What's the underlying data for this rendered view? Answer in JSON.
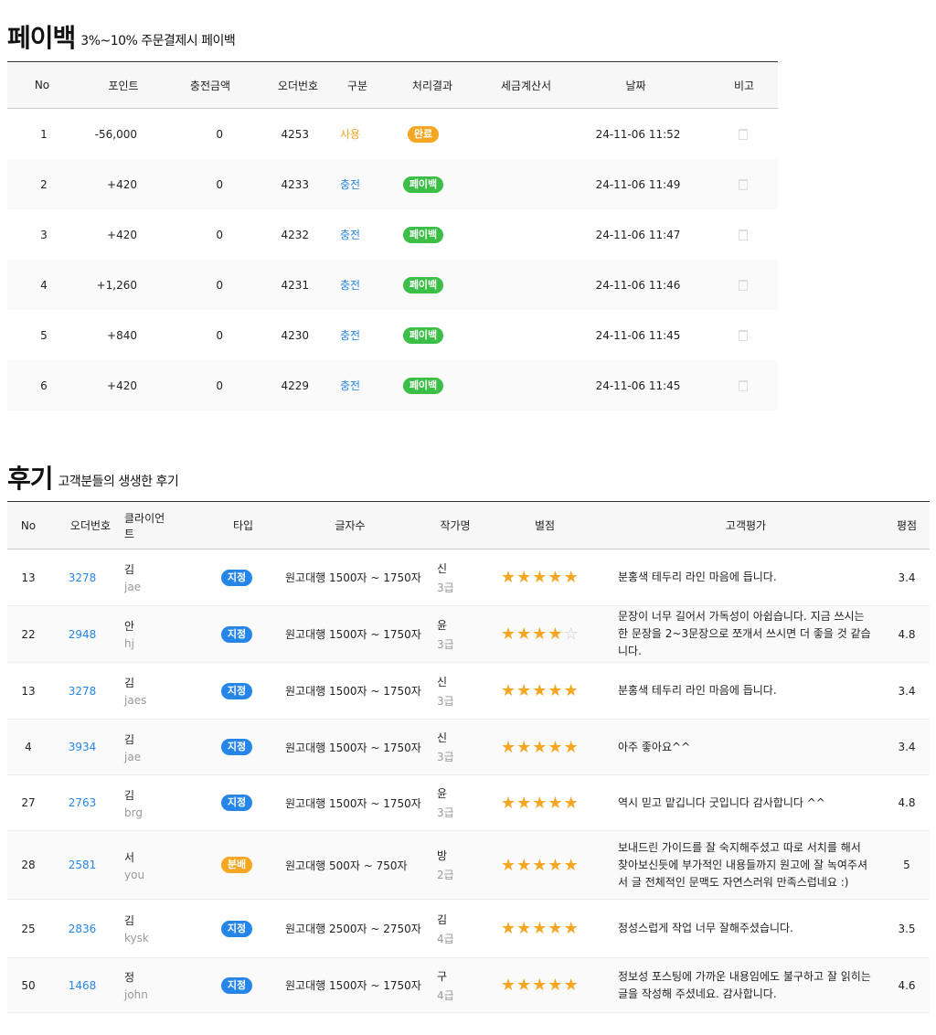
{
  "payback": {
    "title": "페이백",
    "subtitle": "3%~10% 주문결제시 페이백",
    "headers": [
      "No",
      "포인트",
      "충전금액",
      "오더번호",
      "구분",
      "처리결과",
      "세금계산서",
      "날짜",
      "비고"
    ],
    "rows": [
      {
        "no": "1",
        "point": "-56,000",
        "charge": "0",
        "order": "4253",
        "type": "사용",
        "type_kind": "use",
        "result": "완료",
        "result_kind": "orange",
        "tax": "",
        "date": "24-11-06 11:52"
      },
      {
        "no": "2",
        "point": "+420",
        "charge": "0",
        "order": "4233",
        "type": "충전",
        "type_kind": "charge",
        "result": "페이백",
        "result_kind": "green",
        "tax": "",
        "date": "24-11-06 11:49"
      },
      {
        "no": "3",
        "point": "+420",
        "charge": "0",
        "order": "4232",
        "type": "충전",
        "type_kind": "charge",
        "result": "페이백",
        "result_kind": "green",
        "tax": "",
        "date": "24-11-06 11:47"
      },
      {
        "no": "4",
        "point": "+1,260",
        "charge": "0",
        "order": "4231",
        "type": "충전",
        "type_kind": "charge",
        "result": "페이백",
        "result_kind": "green",
        "tax": "",
        "date": "24-11-06 11:46"
      },
      {
        "no": "5",
        "point": "+840",
        "charge": "0",
        "order": "4230",
        "type": "충전",
        "type_kind": "charge",
        "result": "페이백",
        "result_kind": "green",
        "tax": "",
        "date": "24-11-06 11:45"
      },
      {
        "no": "6",
        "point": "+420",
        "charge": "0",
        "order": "4229",
        "type": "충전",
        "type_kind": "charge",
        "result": "페이백",
        "result_kind": "green",
        "tax": "",
        "date": "24-11-06 11:45"
      }
    ],
    "trash_icon": "trash-icon"
  },
  "reviews": {
    "title": "후기",
    "subtitle": "고객분들의 생생한 후기",
    "headers": [
      "No",
      "오더번호",
      "클라이언트",
      "타입",
      "글자수",
      "작가명",
      "별점",
      "고객평가",
      "평점"
    ],
    "rows": [
      {
        "no": "13",
        "order": "3278",
        "client": "김",
        "client_id": "jae",
        "type": "지정",
        "type_kind": "blue",
        "length": "원고대행 1500자 ~ 1750자",
        "writer": "신",
        "grade": "3급",
        "stars": 5,
        "comment": "분홍색 테두리 라인 마음에 듭니다.",
        "score": "3.4"
      },
      {
        "no": "22",
        "order": "2948",
        "client": "안",
        "client_id": "hj",
        "type": "지정",
        "type_kind": "blue",
        "length": "원고대행 1500자 ~ 1750자",
        "writer": "윤",
        "grade": "3급",
        "stars": 4,
        "comment": "문장이 너무 길어서 가독성이 아쉽습니다. 지금 쓰시는 한 문장을 2~3문장으로 쪼개서 쓰시면 더 좋을 것 같습니다.",
        "score": "4.8"
      },
      {
        "no": "13",
        "order": "3278",
        "client": "김",
        "client_id": "jaes",
        "type": "지정",
        "type_kind": "blue",
        "length": "원고대행 1500자 ~ 1750자",
        "writer": "신",
        "grade": "3급",
        "stars": 5,
        "comment": "분홍색 테두리 라인 마음에 듭니다.",
        "score": "3.4"
      },
      {
        "no": "4",
        "order": "3934",
        "client": "김",
        "client_id": "jae",
        "type": "지정",
        "type_kind": "blue",
        "length": "원고대행 1500자 ~ 1750자",
        "writer": "신",
        "grade": "3급",
        "stars": 5,
        "comment": "아주 좋아요^^",
        "score": "3.4"
      },
      {
        "no": "27",
        "order": "2763",
        "client": "김",
        "client_id": "brg",
        "type": "지정",
        "type_kind": "blue",
        "length": "원고대행 1500자 ~ 1750자",
        "writer": "윤",
        "grade": "3급",
        "stars": 5,
        "comment": "역시 믿고 맡깁니다 굿입니다 감사합니다 ^^",
        "score": "4.8"
      },
      {
        "no": "28",
        "order": "2581",
        "client": "서",
        "client_id": "you",
        "type": "분배",
        "type_kind": "orange",
        "length": "원고대행 500자 ~ 750자",
        "writer": "방",
        "grade": "2급",
        "stars": 5,
        "comment": "보내드린 가이드를 잘 숙지해주셨고 따로 서치를 해서 찾아보신듯에 부가적인 내용들까지 원고에 잘 녹여주셔서 글 전체적인 문맥도 자연스러워 만족스럽네요 :)",
        "score": "5"
      },
      {
        "no": "25",
        "order": "2836",
        "client": "김",
        "client_id": "kysk",
        "type": "지정",
        "type_kind": "blue",
        "length": "원고대행 2500자 ~ 2750자",
        "writer": "김",
        "grade": "4급",
        "stars": 5,
        "comment": "정성스럽게 작업 너무 잘해주셨습니다.",
        "score": "3.5"
      },
      {
        "no": "50",
        "order": "1468",
        "client": "정",
        "client_id": "john",
        "type": "지정",
        "type_kind": "blue",
        "length": "원고대행 1500자 ~ 1750자",
        "writer": "구",
        "grade": "4급",
        "stars": 5,
        "comment": "정보성 포스팅에 가까운 내용임에도 불구하고 잘 읽히는 글을 작성해 주셨네요. 감사합니다.",
        "score": "4.6"
      }
    ]
  }
}
